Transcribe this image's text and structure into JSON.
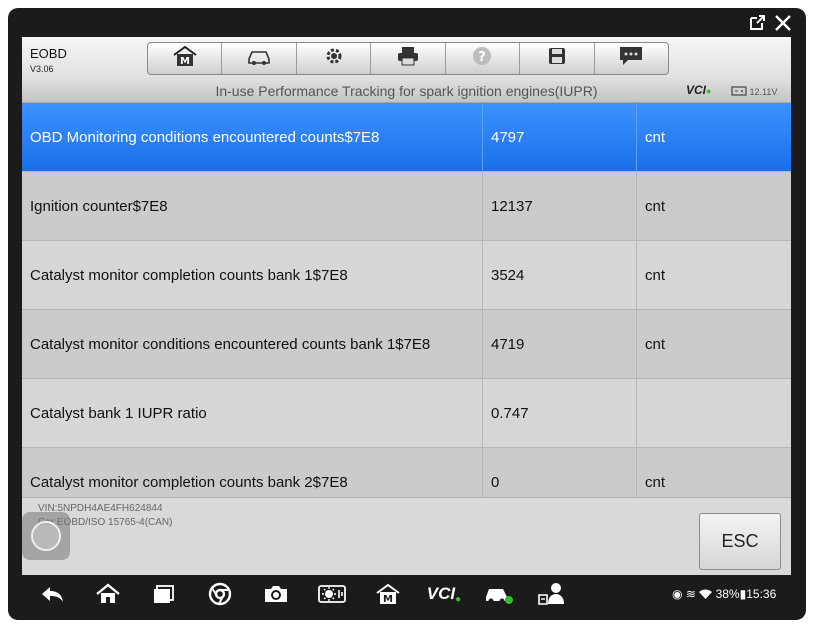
{
  "window": {
    "external_icon": "external-link-icon",
    "close_icon": "close-icon"
  },
  "app": {
    "name": "EOBD",
    "version": "V3.06"
  },
  "toolbar": [
    {
      "name": "home",
      "icon": "home-m-icon"
    },
    {
      "name": "vehicle",
      "icon": "car-icon"
    },
    {
      "name": "settings",
      "icon": "gear-icon"
    },
    {
      "name": "print",
      "icon": "printer-icon"
    },
    {
      "name": "help",
      "icon": "help-icon"
    },
    {
      "name": "save",
      "icon": "save-icon"
    },
    {
      "name": "message",
      "icon": "message-icon"
    }
  ],
  "titlebar": {
    "title": "In-use Performance Tracking for spark ignition engines(IUPR)",
    "vci": "VCI",
    "voltage": "12.11V"
  },
  "rows": [
    {
      "name": "OBD Monitoring conditions encountered counts$7E8",
      "value": "4797",
      "unit": "cnt",
      "selected": true
    },
    {
      "name": "Ignition counter$7E8",
      "value": "12137",
      "unit": "cnt"
    },
    {
      "name": "Catalyst monitor completion counts bank 1$7E8",
      "value": "3524",
      "unit": "cnt"
    },
    {
      "name": "Catalyst monitor conditions encountered counts bank 1$7E8",
      "value": "4719",
      "unit": "cnt"
    },
    {
      "name": "Catalyst bank 1 IUPR ratio",
      "value": "0.747",
      "unit": ""
    },
    {
      "name": "Catalyst monitor completion counts bank 2$7E8",
      "value": "0",
      "unit": "cnt"
    }
  ],
  "footer": {
    "vin": "VIN:5NPDH4AE4FH624844",
    "car": "Car:EOBD/ISO 15765-4(CAN)",
    "esc_label": "ESC"
  },
  "navbar": {
    "icons": [
      "back-icon",
      "home-icon",
      "recent-apps-icon",
      "chrome-icon",
      "camera-icon",
      "brightness-icon",
      "maxisys-home-icon",
      "vci-icon",
      "car-check-icon",
      "technician-icon"
    ],
    "vci_label": "VCI",
    "battery": "38%",
    "time": "15:36"
  },
  "colors": {
    "selected_row": "#1a6fe8",
    "vci_ok": "#2fbf2f"
  }
}
